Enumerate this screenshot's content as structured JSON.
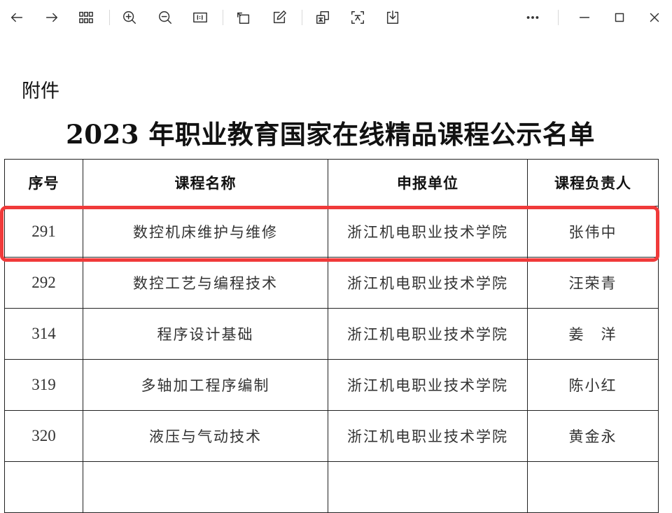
{
  "document": {
    "attachment_label": "附件",
    "title": "2023 年职业教育国家在线精品课程公示名单",
    "table": {
      "headers": [
        "序号",
        "课程名称",
        "申报单位",
        "课程负责人"
      ],
      "rows": [
        {
          "no": "291",
          "course": "数控机床维护与维修",
          "unit": "浙江机电职业技术学院",
          "lead": "张伟中"
        },
        {
          "no": "292",
          "course": "数控工艺与编程技术",
          "unit": "浙江机电职业技术学院",
          "lead": "汪荣青"
        },
        {
          "no": "314",
          "course": "程序设计基础",
          "unit": "浙江机电职业技术学院",
          "lead": "姜　洋"
        },
        {
          "no": "319",
          "course": "多轴加工程序编制",
          "unit": "浙江机电职业技术学院",
          "lead": "陈小红"
        },
        {
          "no": "320",
          "course": "液压与气动技术",
          "unit": "浙江机电职业技术学院",
          "lead": "黄金永"
        }
      ]
    }
  },
  "toolbar": {
    "icons": [
      "back-icon",
      "forward-icon",
      "thumbnails-icon",
      "zoom-in-icon",
      "zoom-out-icon",
      "actual-size-icon",
      "rotate-icon",
      "annotate-icon",
      "translate-icon",
      "ocr-icon",
      "download-icon",
      "more-icon",
      "minimize-icon",
      "maximize-icon",
      "close-icon"
    ]
  },
  "colors": {
    "highlight": "#f03a3a",
    "border": "#222222"
  }
}
